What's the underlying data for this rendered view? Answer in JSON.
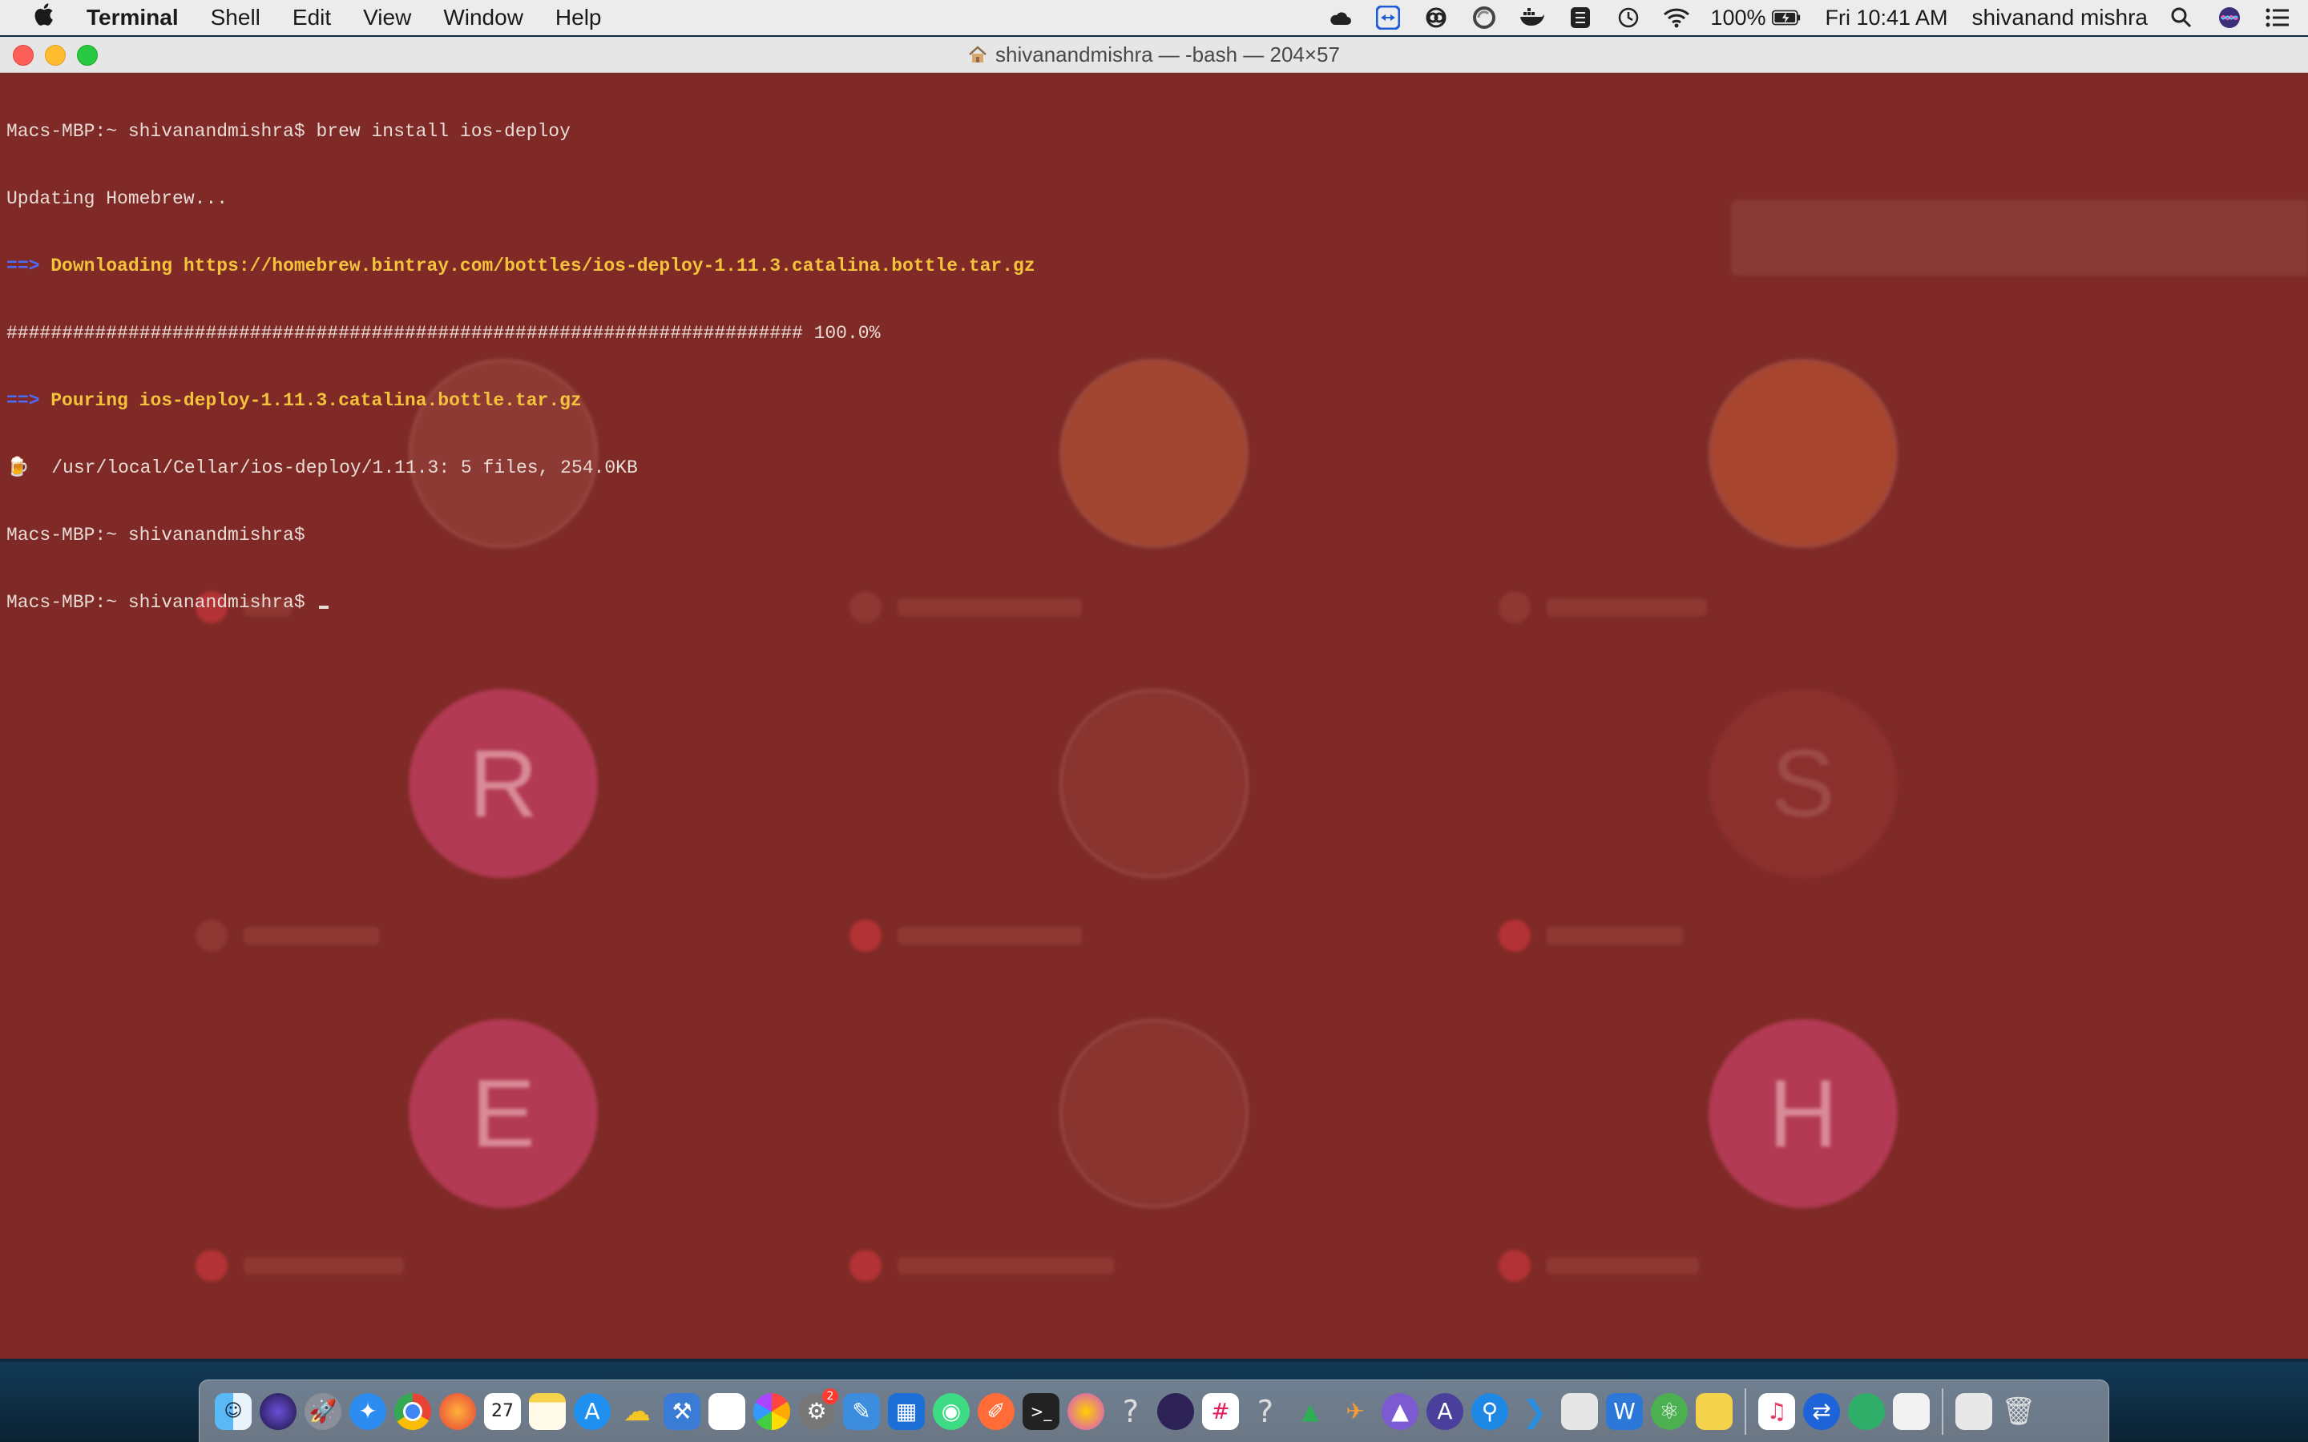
{
  "menubar": {
    "app_name": "Terminal",
    "items": [
      "Shell",
      "Edit",
      "View",
      "Window",
      "Help"
    ],
    "battery": "100%",
    "clock": "Fri 10:41 AM",
    "user": "shivanand mishra",
    "status_icons": [
      "cloud-icon",
      "teamviewer-icon",
      "creative-cloud-icon",
      "sync-icon",
      "docker-icon",
      "vpn-icon",
      "time-machine-icon",
      "wifi-icon",
      "battery-icon",
      "spotlight-icon",
      "siri-icon",
      "notification-center-icon"
    ]
  },
  "window": {
    "title": "shivanandmishra — -bash — 204×57"
  },
  "terminal": {
    "line1": "Macs-MBP:~ shivanandmishra$ brew install ios-deploy",
    "line2": "Updating Homebrew...",
    "line3_arrow": "==>",
    "line3_text": " Downloading https://homebrew.bintray.com/bottles/ios-deploy-1.11.3.catalina.bottle.tar.gz",
    "line4": "######################################################################## 100.0%",
    "line5_arrow": "==>",
    "line5_text": " Pouring ios-deploy-1.11.3.catalina.bottle.tar.gz",
    "line6_icon": "🍺",
    "line6_text": "  /usr/local/Cellar/ios-deploy/1.11.3: 5 files, 254.0KB",
    "line7": "Macs-MBP:~ shivanandmishra$",
    "line8": "Macs-MBP:~ shivanandmishra$ "
  },
  "background": {
    "letters": [
      "R",
      "S",
      "E",
      "H"
    ]
  },
  "dock": {
    "calendar_day": "27",
    "badge_count": "2"
  }
}
